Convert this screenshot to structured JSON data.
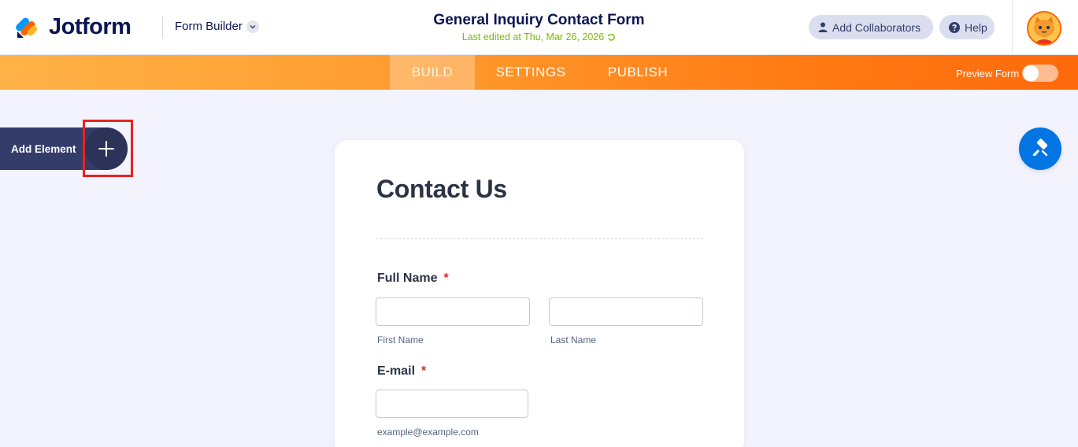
{
  "header": {
    "logo_text": "Jotform",
    "builder_label": "Form Builder",
    "form_title": "General Inquiry Contact Form",
    "last_edited": "Last edited at Thu, Mar 26, 2026",
    "collaborators_label": "Add Collaborators",
    "help_label": "Help"
  },
  "nav": {
    "tabs": [
      {
        "label": "BUILD",
        "active": true
      },
      {
        "label": "SETTINGS",
        "active": false
      },
      {
        "label": "PUBLISH",
        "active": false
      }
    ],
    "preview_label": "Preview Form",
    "preview_enabled": false
  },
  "sidebar": {
    "add_element_label": "Add Element"
  },
  "form": {
    "heading": "Contact Us",
    "fields": [
      {
        "label": "Full Name",
        "required": true,
        "sublabels": [
          "First Name",
          "Last Name"
        ],
        "values": [
          "",
          ""
        ]
      },
      {
        "label": "E-mail",
        "required": true,
        "sublabels": [
          "example@example.com"
        ],
        "values": [
          ""
        ]
      }
    ],
    "required_marker": "*"
  },
  "colors": {
    "accent_orange": "#ff7a13",
    "navy": "#0a1551",
    "designer_blue": "#0075e3",
    "highlight_red": "#e8231c",
    "edited_green": "#78bb07"
  },
  "icons": {
    "logo": "jotform-logo-icon",
    "chevron": "chevron-down-icon",
    "refresh": "refresh-icon",
    "user": "user-icon",
    "help": "help-circle-icon",
    "plus": "plus-icon",
    "designer": "paint-roller-icon"
  }
}
